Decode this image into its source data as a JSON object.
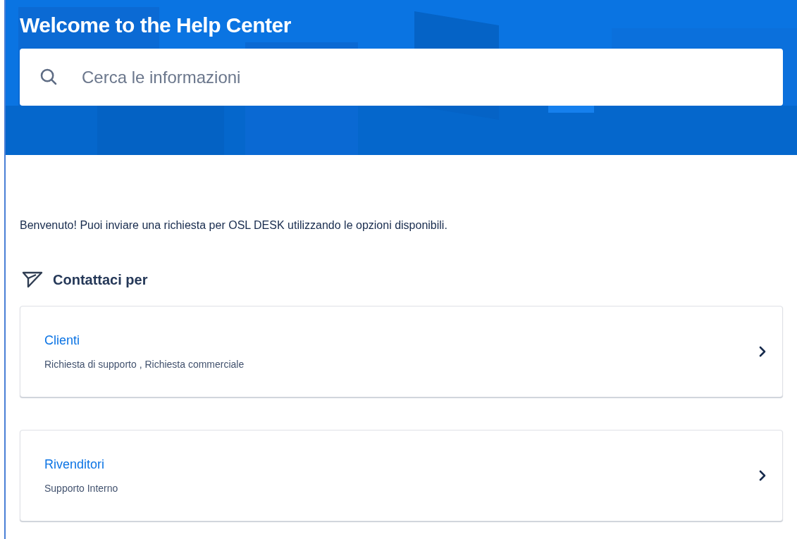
{
  "header": {
    "title": "Welcome to the Help Center"
  },
  "search": {
    "placeholder": "Cerca le informazioni"
  },
  "intro": "Benvenuto! Puoi inviare una richiesta per OSL DESK utilizzando le opzioni disponibili.",
  "contact_section": {
    "title": "Contattaci per",
    "cards": [
      {
        "title": "Clienti",
        "description": "Richiesta di supporto , Richiesta commerciale"
      },
      {
        "title": "Rivenditori",
        "description": "Supporto Interno"
      }
    ]
  }
}
